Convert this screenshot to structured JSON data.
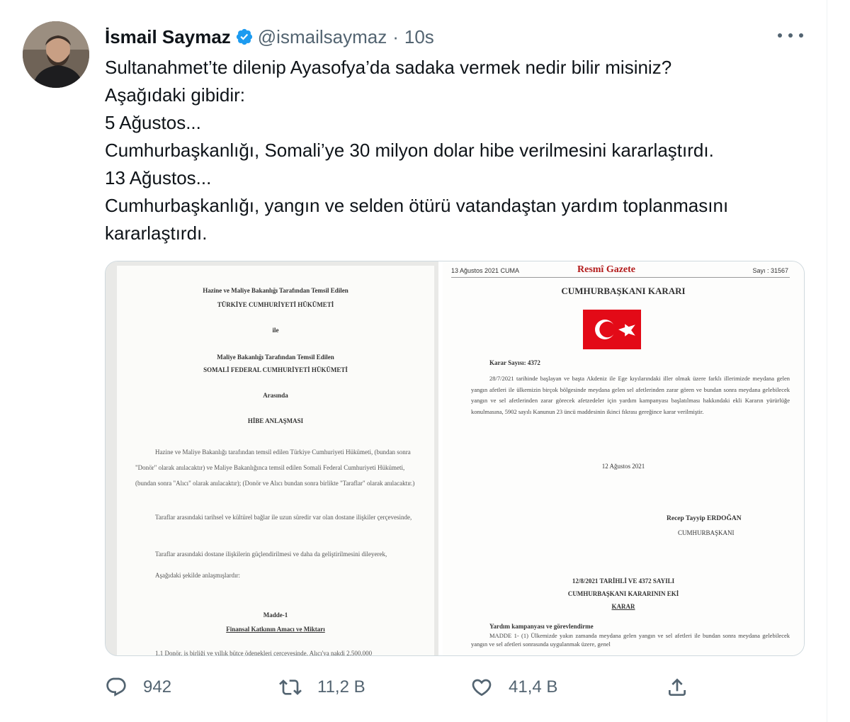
{
  "tweet": {
    "display_name": "İsmail Saymaz",
    "handle": "@ismailsaymaz",
    "separator": "·",
    "time": "10s",
    "lines": [
      "Sultanahmet’te dilenip Ayasofya’da sadaka vermek nedir bilir misiniz?",
      "Aşağıdaki gibidir:",
      "5 Ağustos...",
      "Cumhurbaşkanlığı, Somali’ye 30 milyon dolar hibe verilmesini kararlaştırdı.",
      "13 Ağustos...",
      "Cumhurbaşkanlığı, yangın ve selden ötürü vatandaştan yardım toplanmasını",
      "kararlaştırdı."
    ]
  },
  "media": {
    "left_doc": {
      "line1": "Hazine ve Maliye Bakanlığı Tarafından Temsil Edilen",
      "line2": "TÜRKİYE CUMHURİYETİ HÜKÜMETİ",
      "line3": "ile",
      "line4": "Maliye Bakanlığı Tarafından Temsil Edilen",
      "line5": "SOMALİ FEDERAL CUMHURİYETİ HÜKÜMETİ",
      "line6": "Arasında",
      "line7": "HİBE ANLAŞMASI",
      "para1": "Hazine ve Maliye Bakanlığı tarafından temsil edilen Türkiye Cumhuriyeti Hükümeti, (bundan sonra \"Donör\" olarak anılacaktır) ve Maliye Bakanlığınca temsil edilen Somali Federal Cumhuriyeti Hükümeti, (bundan sonra \"Alıcı\" olarak anılacaktır); (Donör ve Alıcı bundan sonra birlikte \"Taraflar\" olarak anılacaktır.)",
      "para2": "Taraflar arasındaki tarihsel ve kültürel bağlar ile uzun süredir var olan dostane ilişkiler çerçevesinde,",
      "para3": "Taraflar arasındaki dostane ilişkilerin güçlendirilmesi ve daha da geliştirilmesini dileyerek,",
      "para4": "Aşağıdaki şekilde anlaşmışlardır:",
      "madde": "Madde-1",
      "madde_title": "Finansal Katkının Amacı ve Miktarı",
      "last_line": "1.1 Donör, iş birliği ve yıllık bütçe ödenekleri çerçevesinde, Alıcı'ya nakdi 2.500.000"
    },
    "right_doc": {
      "date": "13 Ağustos 2021 CUMA",
      "gazette": "Resmî Gazete",
      "issue": "Sayı : 31567",
      "title": "CUMHURBAŞKANI KARARI",
      "decision_no": "Karar Sayısı: 4372",
      "body": "28/7/2021 tarihinde başlayan ve başta Akdeniz ile Ege kıyılarındaki iller olmak üzere farklı illerimizde meydana gelen yangın afetleri ile ülkemizin birçok bölgesinde meydana gelen sel afetlerinden zarar gören ve bundan sonra meydana gelebilecek yangın ve sel afetlerinden zarar görecek afetzedeler için yardım kampanyası başlatılması hakkındaki ekli Kararın yürürlüğe konulmasına, 5902 sayılı Kanunun 23 üncü maddesinin ikinci fıkrası gereğince karar verilmiştir.",
      "sign_date": "12 Ağustos 2021",
      "signer": "Recep Tayyip ERDOĞAN",
      "signer_title": "CUMHURBAŞKANI",
      "annex1": "12/8/2021 TARİHLİ VE 4372 SAYILI",
      "annex2": "CUMHURBAŞKANI KARARININ EKİ",
      "annex3": "KARAR",
      "section": "Yardım kampanyası ve görevlendirme",
      "article": "MADDE 1- (1) Ülkemizde yakın zamanda meydana gelen yangın ve sel afetleri ile bundan sonra meydana gelebilecek yangın ve sel afetleri sonrasında uygulanmak üzere, genel"
    }
  },
  "actions": {
    "reply_count": "942",
    "retweet_count": "11,2 B",
    "like_count": "41,4 B"
  },
  "colors": {
    "verified": "#1d9bf0",
    "secondary_text": "#536471",
    "flag_red": "#e30a17",
    "gazette_red": "#b31b1b"
  },
  "icons": [
    "verified-icon",
    "more-icon",
    "reply-icon",
    "retweet-icon",
    "like-icon",
    "share-icon"
  ]
}
